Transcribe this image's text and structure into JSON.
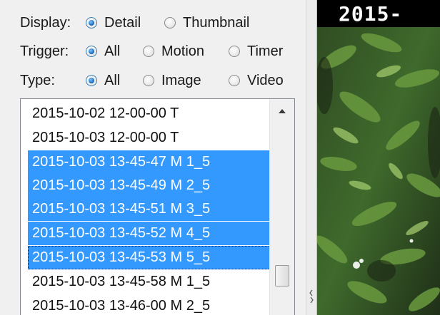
{
  "filters": {
    "display": {
      "label": "Display:",
      "options": [
        {
          "label": "Detail",
          "selected": true
        },
        {
          "label": "Thumbnail",
          "selected": false
        }
      ]
    },
    "trigger": {
      "label": "Trigger:",
      "options": [
        {
          "label": "All",
          "selected": true
        },
        {
          "label": "Motion",
          "selected": false
        },
        {
          "label": "Timer",
          "selected": false
        }
      ]
    },
    "type": {
      "label": "Type:",
      "options": [
        {
          "label": "All",
          "selected": true
        },
        {
          "label": "Image",
          "selected": false
        },
        {
          "label": "Video",
          "selected": false
        }
      ]
    }
  },
  "file_list": {
    "items": [
      {
        "label": "2015-10-02 12-00-00 T",
        "selected": false,
        "focused": false
      },
      {
        "label": "2015-10-03 12-00-00 T",
        "selected": false,
        "focused": false
      },
      {
        "label": "2015-10-03 13-45-47 M 1_5",
        "selected": true,
        "focused": false
      },
      {
        "label": "2015-10-03 13-45-49 M 2_5",
        "selected": true,
        "focused": false
      },
      {
        "label": "2015-10-03 13-45-51 M 3_5",
        "selected": true,
        "focused": false
      },
      {
        "label": "2015-10-03 13-45-52 M 4_5",
        "selected": true,
        "focused": false
      },
      {
        "label": "2015-10-03 13-45-53 M 5_5",
        "selected": true,
        "focused": true
      },
      {
        "label": "2015-10-03 13-45-58 M 1_5",
        "selected": false,
        "focused": false
      },
      {
        "label": "2015-10-03 13-46-00 M 2_5",
        "selected": false,
        "focused": false
      }
    ],
    "scroll_up_icon": "triangle-up"
  },
  "preview": {
    "timestamp": "2015-"
  },
  "colors": {
    "selection": "#3399ff",
    "selection_text": "#ffffff",
    "window_bg": "#f0f0f0",
    "radio_dot": "#1c6fc0"
  }
}
